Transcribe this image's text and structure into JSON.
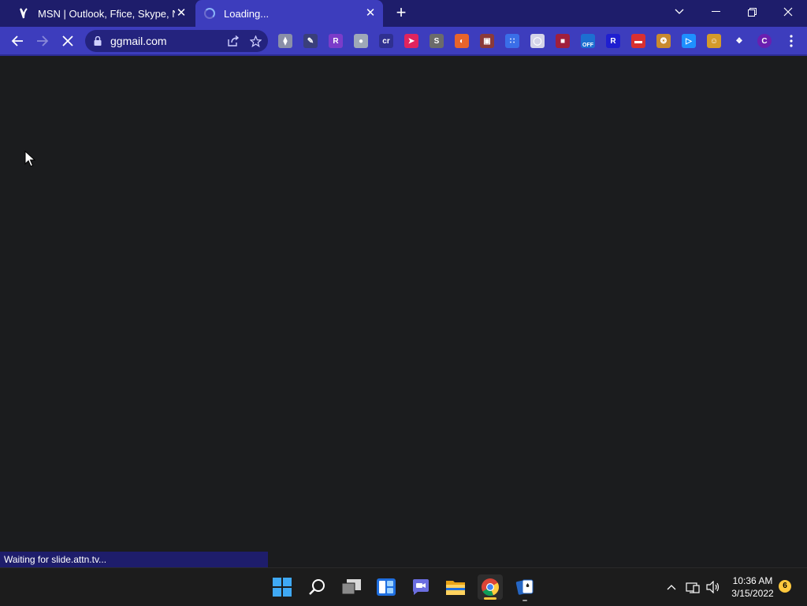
{
  "browser": {
    "tabs": [
      {
        "title": "MSN | Outlook, Ffice, Skype, Ning",
        "favicon": "msn-butterfly-icon",
        "active": false
      },
      {
        "title": "Loading...",
        "favicon": "loading-spinner-icon",
        "active": true
      }
    ],
    "address": "ggmail.com",
    "status_text": "Waiting for slide.attn.tv...",
    "colors": {
      "frame": "#1e1d6b",
      "toolbar": "#3d3dbd",
      "content": "#1b1c1e"
    }
  },
  "extensions": [
    {
      "name": "ext-1-icon",
      "glyph": "⧫",
      "color": "#8a8fa8"
    },
    {
      "name": "ext-2-icon",
      "glyph": "✎",
      "color": "#3a3f7a"
    },
    {
      "name": "ext-3-icon",
      "glyph": "R",
      "color": "#7b3cc9"
    },
    {
      "name": "ext-4-icon",
      "glyph": "●",
      "color": "#9ea8b8"
    },
    {
      "name": "ext-5-icon",
      "glyph": "cr",
      "color": "#2f3090"
    },
    {
      "name": "ext-6-icon",
      "glyph": "➤",
      "color": "#e0245e"
    },
    {
      "name": "ext-7-icon",
      "glyph": "S",
      "color": "#6b6b6b"
    },
    {
      "name": "ext-8-icon",
      "glyph": "◐",
      "color": "#e8642b"
    },
    {
      "name": "ext-9-icon",
      "glyph": "▣",
      "color": "#8a3a3a"
    },
    {
      "name": "ext-10-icon",
      "glyph": "∷",
      "color": "#3a6ee8"
    },
    {
      "name": "ext-11-icon",
      "glyph": "◯",
      "color": "#d4d4e8"
    },
    {
      "name": "ext-12-icon",
      "glyph": "■",
      "color": "#a01f3c"
    },
    {
      "name": "ext-13-icon",
      "glyph": "OFF",
      "color": "#1d6fd1"
    },
    {
      "name": "ext-14-icon",
      "glyph": "R",
      "color": "#1f1fd0"
    },
    {
      "name": "ext-15-icon",
      "glyph": "▬",
      "color": "#d93030"
    },
    {
      "name": "ext-16-icon",
      "glyph": "❂",
      "color": "#c98a2e"
    },
    {
      "name": "ext-17-icon",
      "glyph": "▷",
      "color": "#1e90ff"
    },
    {
      "name": "ext-18-icon",
      "glyph": "☺",
      "color": "#d49a2a"
    },
    {
      "name": "extensions-puzzle-icon",
      "glyph": "❖",
      "color": "#3d3dbd"
    },
    {
      "name": "profile-avatar-icon",
      "glyph": "C",
      "color": "#6a1fb0"
    }
  ],
  "taskbar": {
    "apps": [
      {
        "name": "start-button",
        "label": "Start"
      },
      {
        "name": "search-button",
        "label": "Search"
      },
      {
        "name": "task-view-button",
        "label": "Task View"
      },
      {
        "name": "widgets-button",
        "label": "Widgets"
      },
      {
        "name": "chat-button",
        "label": "Chat"
      },
      {
        "name": "file-explorer-button",
        "label": "File Explorer"
      },
      {
        "name": "chrome-button",
        "label": "Google Chrome"
      },
      {
        "name": "solitaire-button",
        "label": "Solitaire"
      }
    ],
    "time": "10:36 AM",
    "date": "3/15/2022",
    "notifications": "6"
  }
}
